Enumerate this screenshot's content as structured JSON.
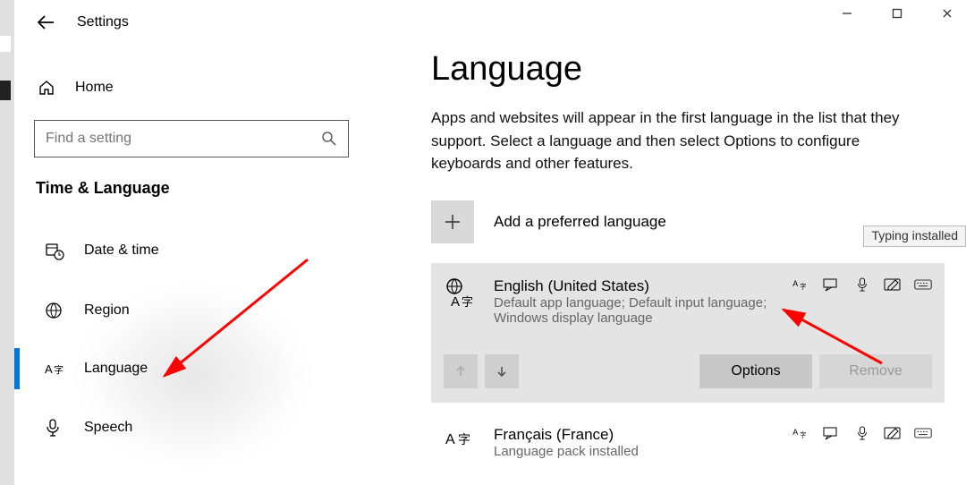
{
  "app_title": "Settings",
  "home_label": "Home",
  "search": {
    "placeholder": "Find a setting"
  },
  "section_header": "Time & Language",
  "nav": [
    {
      "key": "datetime",
      "label": "Date & time"
    },
    {
      "key": "region",
      "label": "Region"
    },
    {
      "key": "language",
      "label": "Language"
    },
    {
      "key": "speech",
      "label": "Speech"
    }
  ],
  "page_title": "Language",
  "page_desc": "Apps and websites will appear in the first language in the list that they support. Select a language and then select Options to configure keyboards and other features.",
  "add_label": "Add a preferred language",
  "tooltip": "Typing installed",
  "languages": [
    {
      "name": "English (United States)",
      "subtitle": "Default app language; Default input language; Windows display language",
      "selected": true
    },
    {
      "name": "Français (France)",
      "subtitle": "Language pack installed",
      "selected": false
    }
  ],
  "buttons": {
    "options": "Options",
    "remove": "Remove"
  }
}
